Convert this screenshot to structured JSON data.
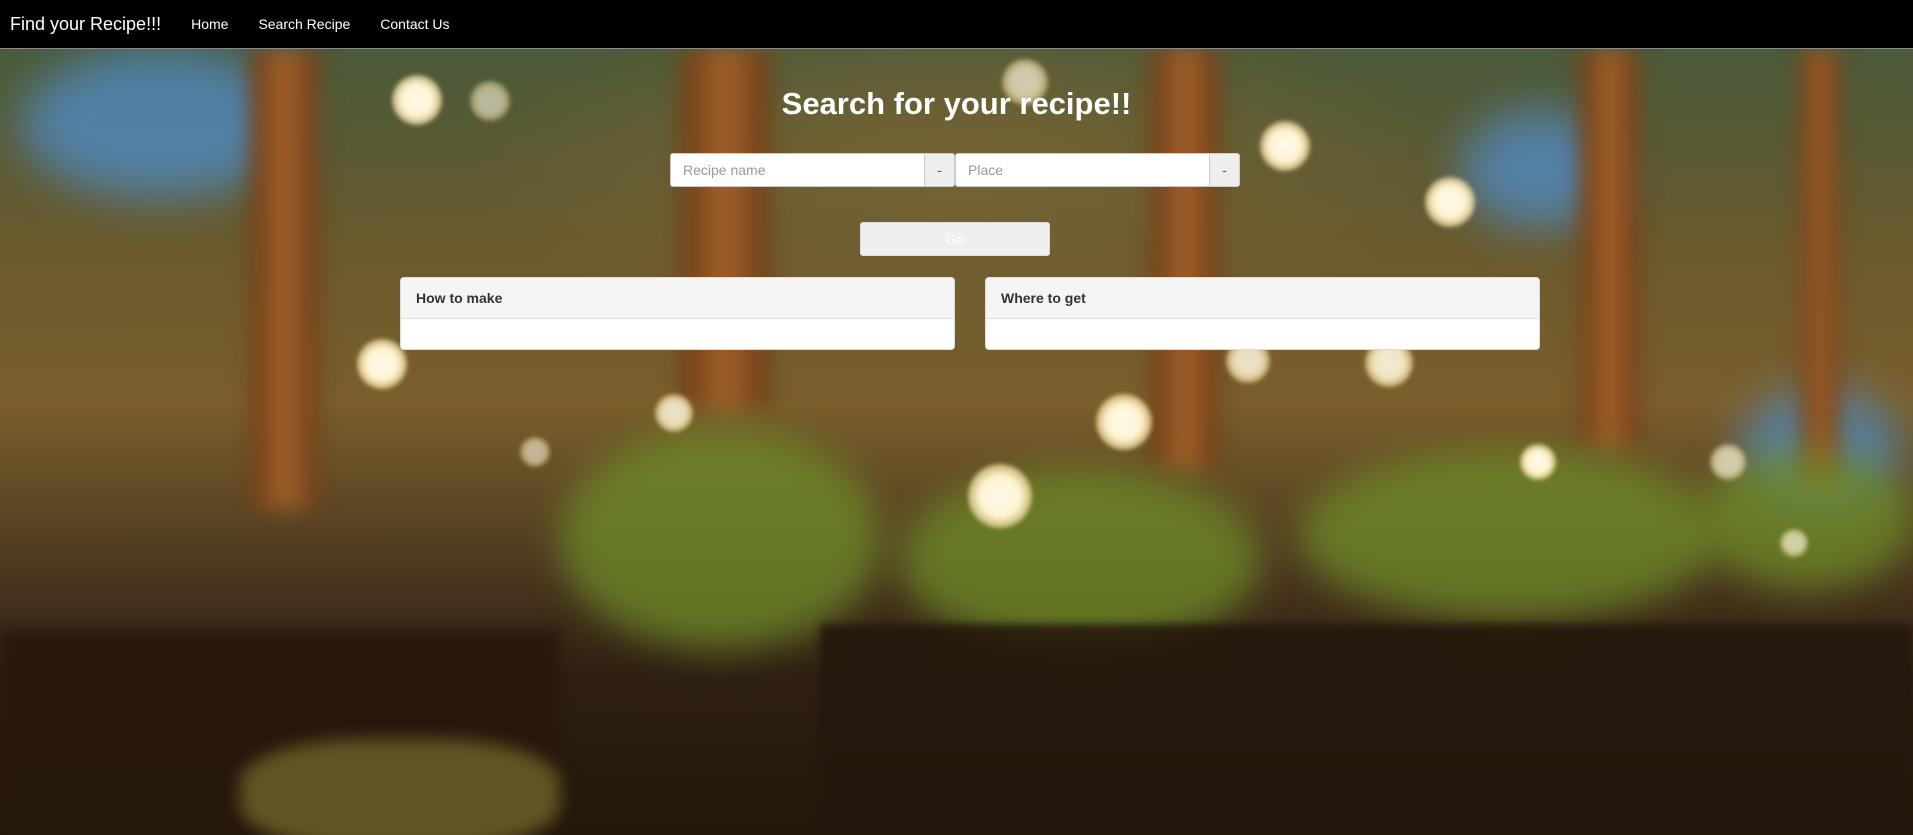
{
  "navbar": {
    "brand": "Find your Recipe!!!",
    "links": [
      "Home",
      "Search Recipe",
      "Contact Us"
    ]
  },
  "search": {
    "title": "Search for your recipe!!",
    "recipe_placeholder": "Recipe name",
    "recipe_addon": "-",
    "place_placeholder": "Place",
    "place_addon": "-",
    "go_label": "Go"
  },
  "panels": {
    "how_to_make": "How to make",
    "where_to_get": "Where to get"
  }
}
